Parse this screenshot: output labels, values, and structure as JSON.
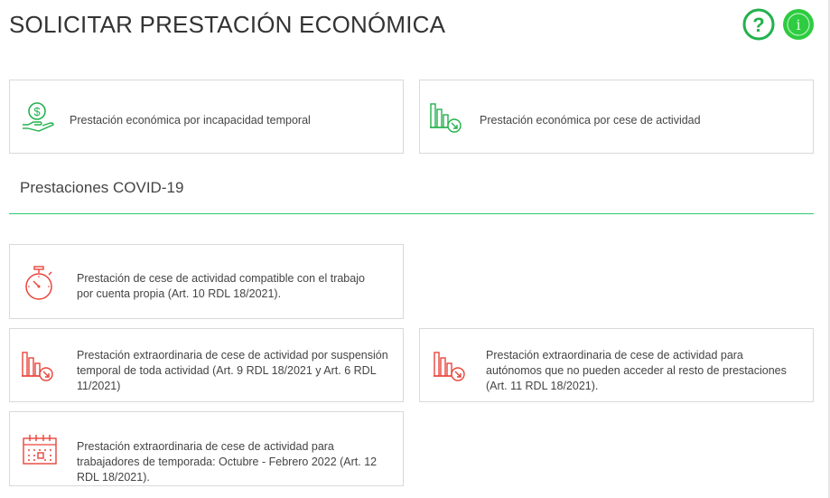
{
  "header": {
    "title": "SOLICITAR PRESTACIÓN ECONÓMICA",
    "help_glyph": "?",
    "info_glyph": "i"
  },
  "cards": [
    {
      "label": "Prestación económica por incapacidad temporal",
      "icon": "money-hand-icon"
    },
    {
      "label": "Prestación económica por cese de actividad",
      "icon": "bar-chart-down-icon"
    }
  ],
  "covid": {
    "title": "Prestaciones COVID-19",
    "cards": [
      {
        "label": "Prestación de cese de actividad compatible con el trabajo por cuenta propia (Art. 10 RDL 18/2021).",
        "icon": "stopwatch-icon"
      },
      {
        "label": "Prestación extraordinaria de cese de actividad por suspensión temporal de toda actividad (Art. 9 RDL 18/2021 y Art. 6 RDL 11/2021)",
        "icon": "bar-chart-down-icon"
      },
      {
        "label": "Prestación extraordinaria de cese de actividad para autónomos que no pueden acceder al resto de prestaciones (Art. 11 RDL 18/2021).",
        "icon": "bar-chart-down-icon"
      },
      {
        "label": "Prestación extraordinaria de cese de actividad para trabajadores de temporada: Octubre - Febrero 2022 (Art. 12 RDL 18/2021).",
        "icon": "calendar-icon"
      }
    ]
  },
  "colors": {
    "green": "#22b14c",
    "red": "#e8443a",
    "divider": "#2ecc71"
  }
}
